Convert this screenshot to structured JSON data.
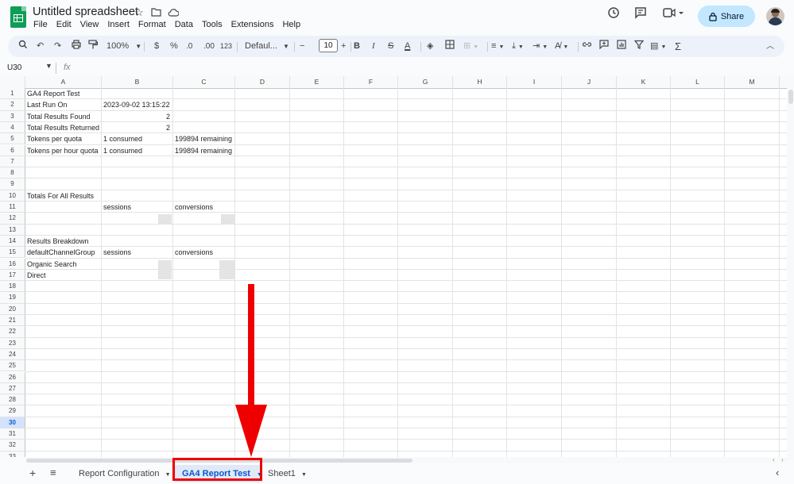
{
  "app": {
    "title": "Untitled spreadsheet",
    "menu": [
      "File",
      "Edit",
      "View",
      "Insert",
      "Format",
      "Data",
      "Tools",
      "Extensions",
      "Help"
    ],
    "share_label": "Share"
  },
  "toolbar": {
    "zoom": "100%",
    "currency": "$",
    "percent": "%",
    "dec_decrease": ".0",
    "dec_increase": ".00",
    "number_format": "123",
    "font": "Defaul...",
    "font_size": "10",
    "bold": "B",
    "italic": "I",
    "text_color": "A"
  },
  "formula_bar": {
    "name_box": "U30",
    "fx": "fx"
  },
  "grid": {
    "columns": [
      "A",
      "B",
      "C",
      "D",
      "E",
      "F",
      "G",
      "H",
      "I",
      "J",
      "K",
      "L",
      "M"
    ],
    "rows": [
      "1",
      "2",
      "3",
      "4",
      "5",
      "6",
      "7",
      "8",
      "9",
      "10",
      "11",
      "12",
      "13",
      "14",
      "15",
      "16",
      "17",
      "18",
      "19",
      "20",
      "21",
      "22",
      "23",
      "24",
      "25",
      "26",
      "27",
      "28",
      "29",
      "30",
      "31",
      "32",
      "33"
    ],
    "selected_row": "30",
    "cells": {
      "A1": "GA4 Report Test",
      "A2": "Last Run On",
      "B2": "2023-09-02 13:15:22",
      "A3": "Total Results Found",
      "B3": "2",
      "A4": "Total Results Returned",
      "B4": "2",
      "A5": "Tokens per quota",
      "B5": "1 consumed",
      "C5": "199894 remaining",
      "A6": "Tokens per hour quota",
      "B6": "1 consumed",
      "C6": "199894 remaining",
      "A10": "Totals For All Results",
      "B11": "sessions",
      "C11": "conversions",
      "A14": "Results Breakdown",
      "A15": "defaultChannelGroup",
      "B15": "sessions",
      "C15": "conversions",
      "A16": "Organic Search",
      "A17": "Direct"
    }
  },
  "sheets": {
    "tabs": [
      "Report Configuration",
      "GA4 Report Test",
      "Sheet1"
    ],
    "active": "GA4 Report Test"
  },
  "colors": {
    "highlight": "#e00000",
    "arrow": "#e00000",
    "active_tab": "#0b57d0",
    "share_bg": "#c2e7ff"
  }
}
